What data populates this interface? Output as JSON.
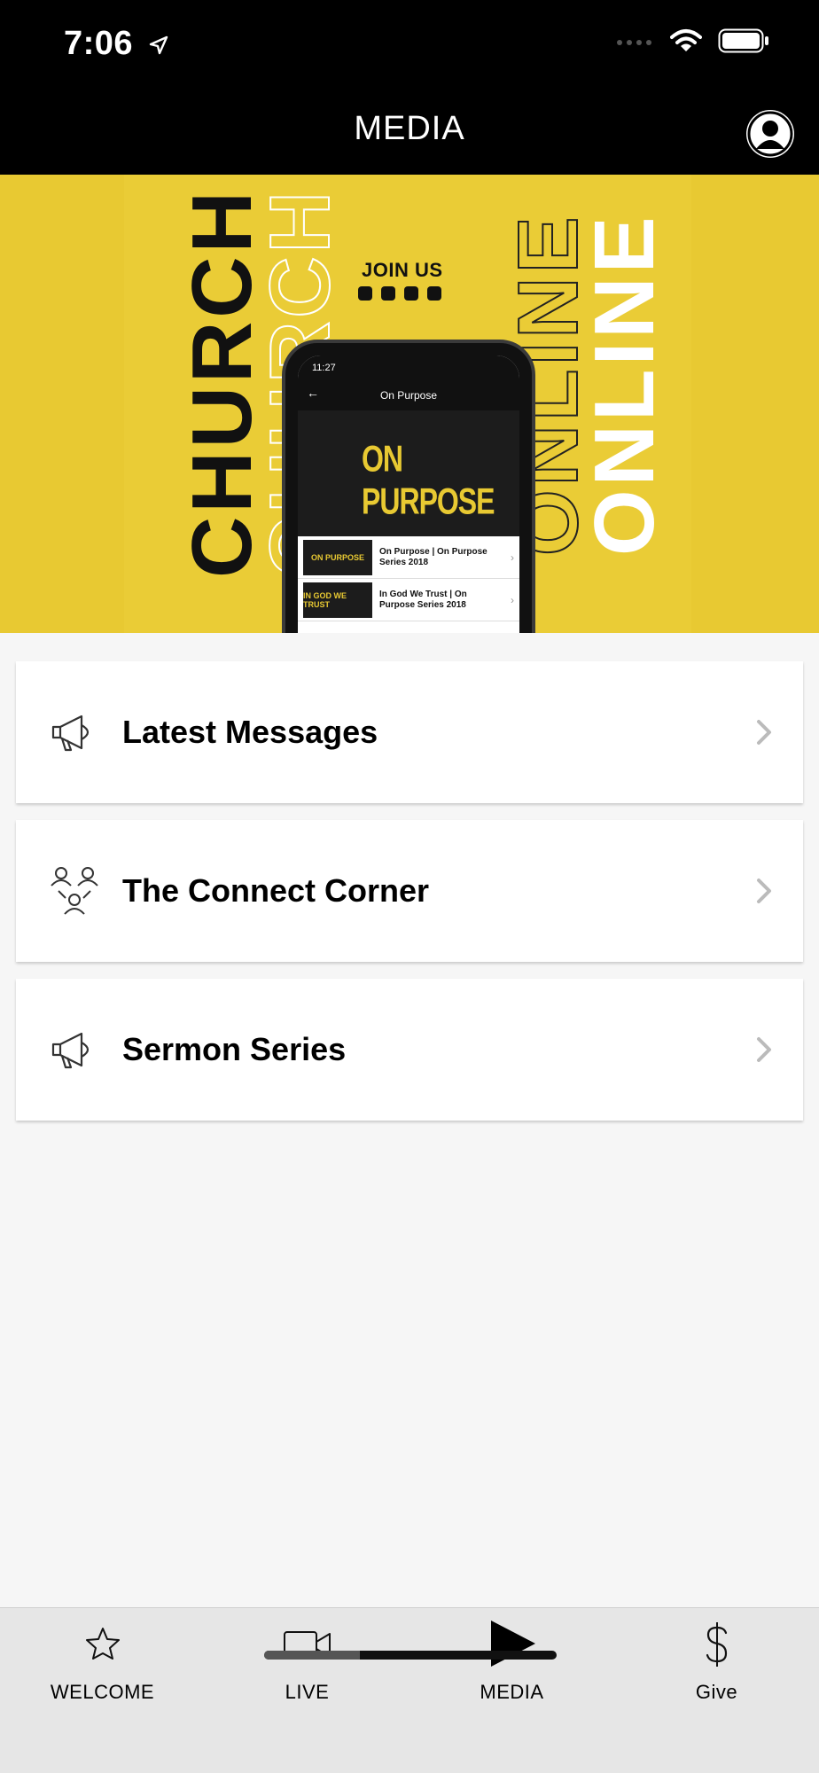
{
  "status_bar": {
    "time": "7:06"
  },
  "header": {
    "title": "MEDIA"
  },
  "banner": {
    "word_left": "CHURCH",
    "word_right": "ONLINE",
    "join_text": "JOIN US",
    "phone": {
      "time": "11:27",
      "title": "On Purpose",
      "hero_text": "ON PURPOSE",
      "rows": [
        {
          "thumb": "ON PURPOSE",
          "text": "On Purpose | On Purpose Series 2018"
        },
        {
          "thumb": "IN GOD WE TRUST",
          "text": "In God We Trust | On Purpose Series 2018"
        }
      ]
    }
  },
  "menu": {
    "items": [
      {
        "label": "Latest Messages",
        "icon": "megaphone-icon"
      },
      {
        "label": "The Connect Corner",
        "icon": "people-network-icon"
      },
      {
        "label": "Sermon Series",
        "icon": "megaphone-icon"
      }
    ]
  },
  "tabbar": {
    "tabs": [
      {
        "label": "WELCOME",
        "icon": "star-icon"
      },
      {
        "label": "LIVE",
        "icon": "video-camera-icon"
      },
      {
        "label": "MEDIA",
        "icon": "play-icon",
        "active": true
      },
      {
        "label": "Give",
        "icon": "dollar-icon"
      }
    ]
  }
}
